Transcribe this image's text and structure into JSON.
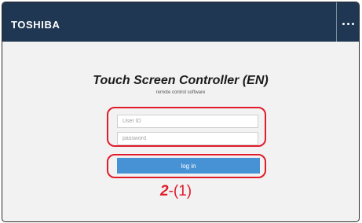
{
  "header": {
    "brand": "TOSHIBA",
    "menu_icon": "ellipsis-icon"
  },
  "login": {
    "title": "Touch Screen Controller (EN)",
    "subtitle": "remote control software",
    "user_id_placeholder": "User ID",
    "user_id_value": "",
    "password_placeholder": "password",
    "password_value": "",
    "login_label": "log in"
  },
  "annotation": {
    "step_number": "2",
    "step_suffix": "-(1)",
    "highlight_color": "#e11c2a"
  },
  "colors": {
    "header_bg": "#1f3752",
    "button_bg": "#4792d5",
    "page_bg": "#f2f2f2"
  }
}
